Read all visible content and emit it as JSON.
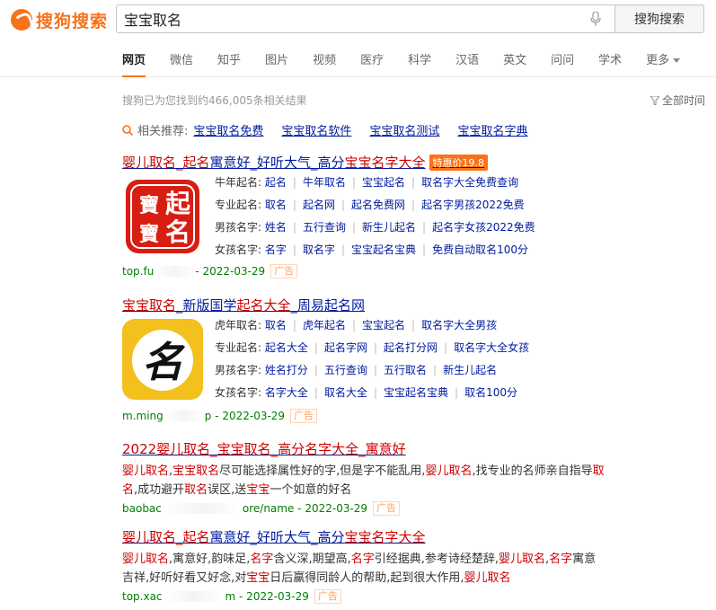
{
  "header": {
    "logo_text": "搜狗搜索",
    "search_value": "宝宝取名",
    "search_button": "搜狗搜索",
    "tabs": [
      "网页",
      "微信",
      "知乎",
      "图片",
      "视频",
      "医疗",
      "科学",
      "汉语",
      "英文",
      "问问",
      "学术",
      "更多"
    ]
  },
  "stats": {
    "text": "搜狗已为您找到约466,005条相关结果",
    "time_filter": "全部时间"
  },
  "related": {
    "label": "相关推荐:",
    "items": [
      "宝宝取名免费",
      "宝宝取名软件",
      "宝宝取名测试",
      "宝宝取名字典"
    ]
  },
  "results": [
    {
      "title_parts": [
        {
          "t": "婴儿取名_起名",
          "hl": true
        },
        {
          "t": "寓意好_好听大气_高分",
          "hl": false
        },
        {
          "t": "宝宝名字大全",
          "hl": true
        }
      ],
      "badge": "特惠价19.8",
      "thumb_text": [
        "起",
        "寶",
        "名",
        "寶"
      ],
      "rows": [
        {
          "label": "牛年起名:",
          "links": [
            "起名",
            "牛年取名",
            "宝宝起名",
            "取名字大全免费查询"
          ]
        },
        {
          "label": "专业起名:",
          "links": [
            "取名",
            "起名网",
            "起名免费网",
            "起名字男孩2022免费"
          ]
        },
        {
          "label": "男孩名字:",
          "links": [
            "姓名",
            "五行查询",
            "新生儿起名",
            "起名字女孩2022免费"
          ]
        },
        {
          "label": "女孩名字:",
          "links": [
            "名字",
            "取名字",
            "宝宝起名宝典",
            "免费自动取名100分"
          ]
        }
      ],
      "url_start": "top.fu",
      "url_end": " - 2022-03-29",
      "ad": "广告"
    },
    {
      "title_parts": [
        {
          "t": "宝宝取名",
          "hl": true
        },
        {
          "t": "_新版国学",
          "hl": false
        },
        {
          "t": "起名大全",
          "hl": true
        },
        {
          "t": "_周易起名网",
          "hl": false
        }
      ],
      "thumb_text": [
        "名"
      ],
      "rows": [
        {
          "label": "虎年取名:",
          "links": [
            "取名",
            "虎年起名",
            "宝宝起名",
            "取名字大全男孩"
          ]
        },
        {
          "label": "专业起名:",
          "links": [
            "起名大全",
            "起名字网",
            "起名打分网",
            "取名字大全女孩"
          ]
        },
        {
          "label": "男孩名字:",
          "links": [
            "姓名打分",
            "五行查询",
            "五行取名",
            "新生儿起名"
          ]
        },
        {
          "label": "女孩名字:",
          "links": [
            "名字大全",
            "取名大全",
            "宝宝起名宝典",
            "取名100分"
          ]
        }
      ],
      "url_start": "m.ming",
      "url_end": "p - 2022-03-29",
      "ad": "广告"
    },
    {
      "title_parts": [
        {
          "t": "2022婴儿取名_宝宝取名_高分名字大全_寓意好",
          "hl": false
        }
      ],
      "snippet": [
        {
          "t": "婴儿取名",
          "hl": true
        },
        {
          "t": ",",
          "hl": false
        },
        {
          "t": "宝宝取名",
          "hl": true
        },
        {
          "t": "尽可能选择属性好的字,但是字不能乱用,",
          "hl": false
        },
        {
          "t": "婴儿取名",
          "hl": true
        },
        {
          "t": ",找专业的名师亲自指导",
          "hl": false
        },
        {
          "t": "取名",
          "hl": true
        },
        {
          "t": ",成功避开",
          "hl": false
        },
        {
          "t": "取名",
          "hl": true
        },
        {
          "t": "误区,送",
          "hl": false
        },
        {
          "t": "宝宝",
          "hl": true
        },
        {
          "t": "一个如意的好名",
          "hl": false
        }
      ],
      "url_start": "baobac",
      "url_end": "ore/name - 2022-03-29",
      "ad": "广告"
    },
    {
      "title_parts": [
        {
          "t": "婴儿取名_起名",
          "hl": true
        },
        {
          "t": "寓意好_好听大气_高分",
          "hl": false
        },
        {
          "t": "宝宝名字大全",
          "hl": true
        }
      ],
      "snippet": [
        {
          "t": "婴儿取名",
          "hl": true
        },
        {
          "t": ",寓意好,韵味足,",
          "hl": false
        },
        {
          "t": "名字",
          "hl": true
        },
        {
          "t": "含义深,期望高,",
          "hl": false
        },
        {
          "t": "名字",
          "hl": true
        },
        {
          "t": "引经据典,参考诗经楚辞,",
          "hl": false
        },
        {
          "t": "婴儿取名",
          "hl": true
        },
        {
          "t": ",",
          "hl": false
        },
        {
          "t": "名字",
          "hl": true
        },
        {
          "t": "寓意吉祥,好听好看又好念,对",
          "hl": false
        },
        {
          "t": "宝宝",
          "hl": true
        },
        {
          "t": "日后赢得同龄人的帮助,起到很大作用,",
          "hl": false
        },
        {
          "t": "婴儿取名",
          "hl": true
        }
      ],
      "url_start": "top.xac",
      "url_end": "m - 2022-03-29",
      "ad": "广告"
    }
  ]
}
